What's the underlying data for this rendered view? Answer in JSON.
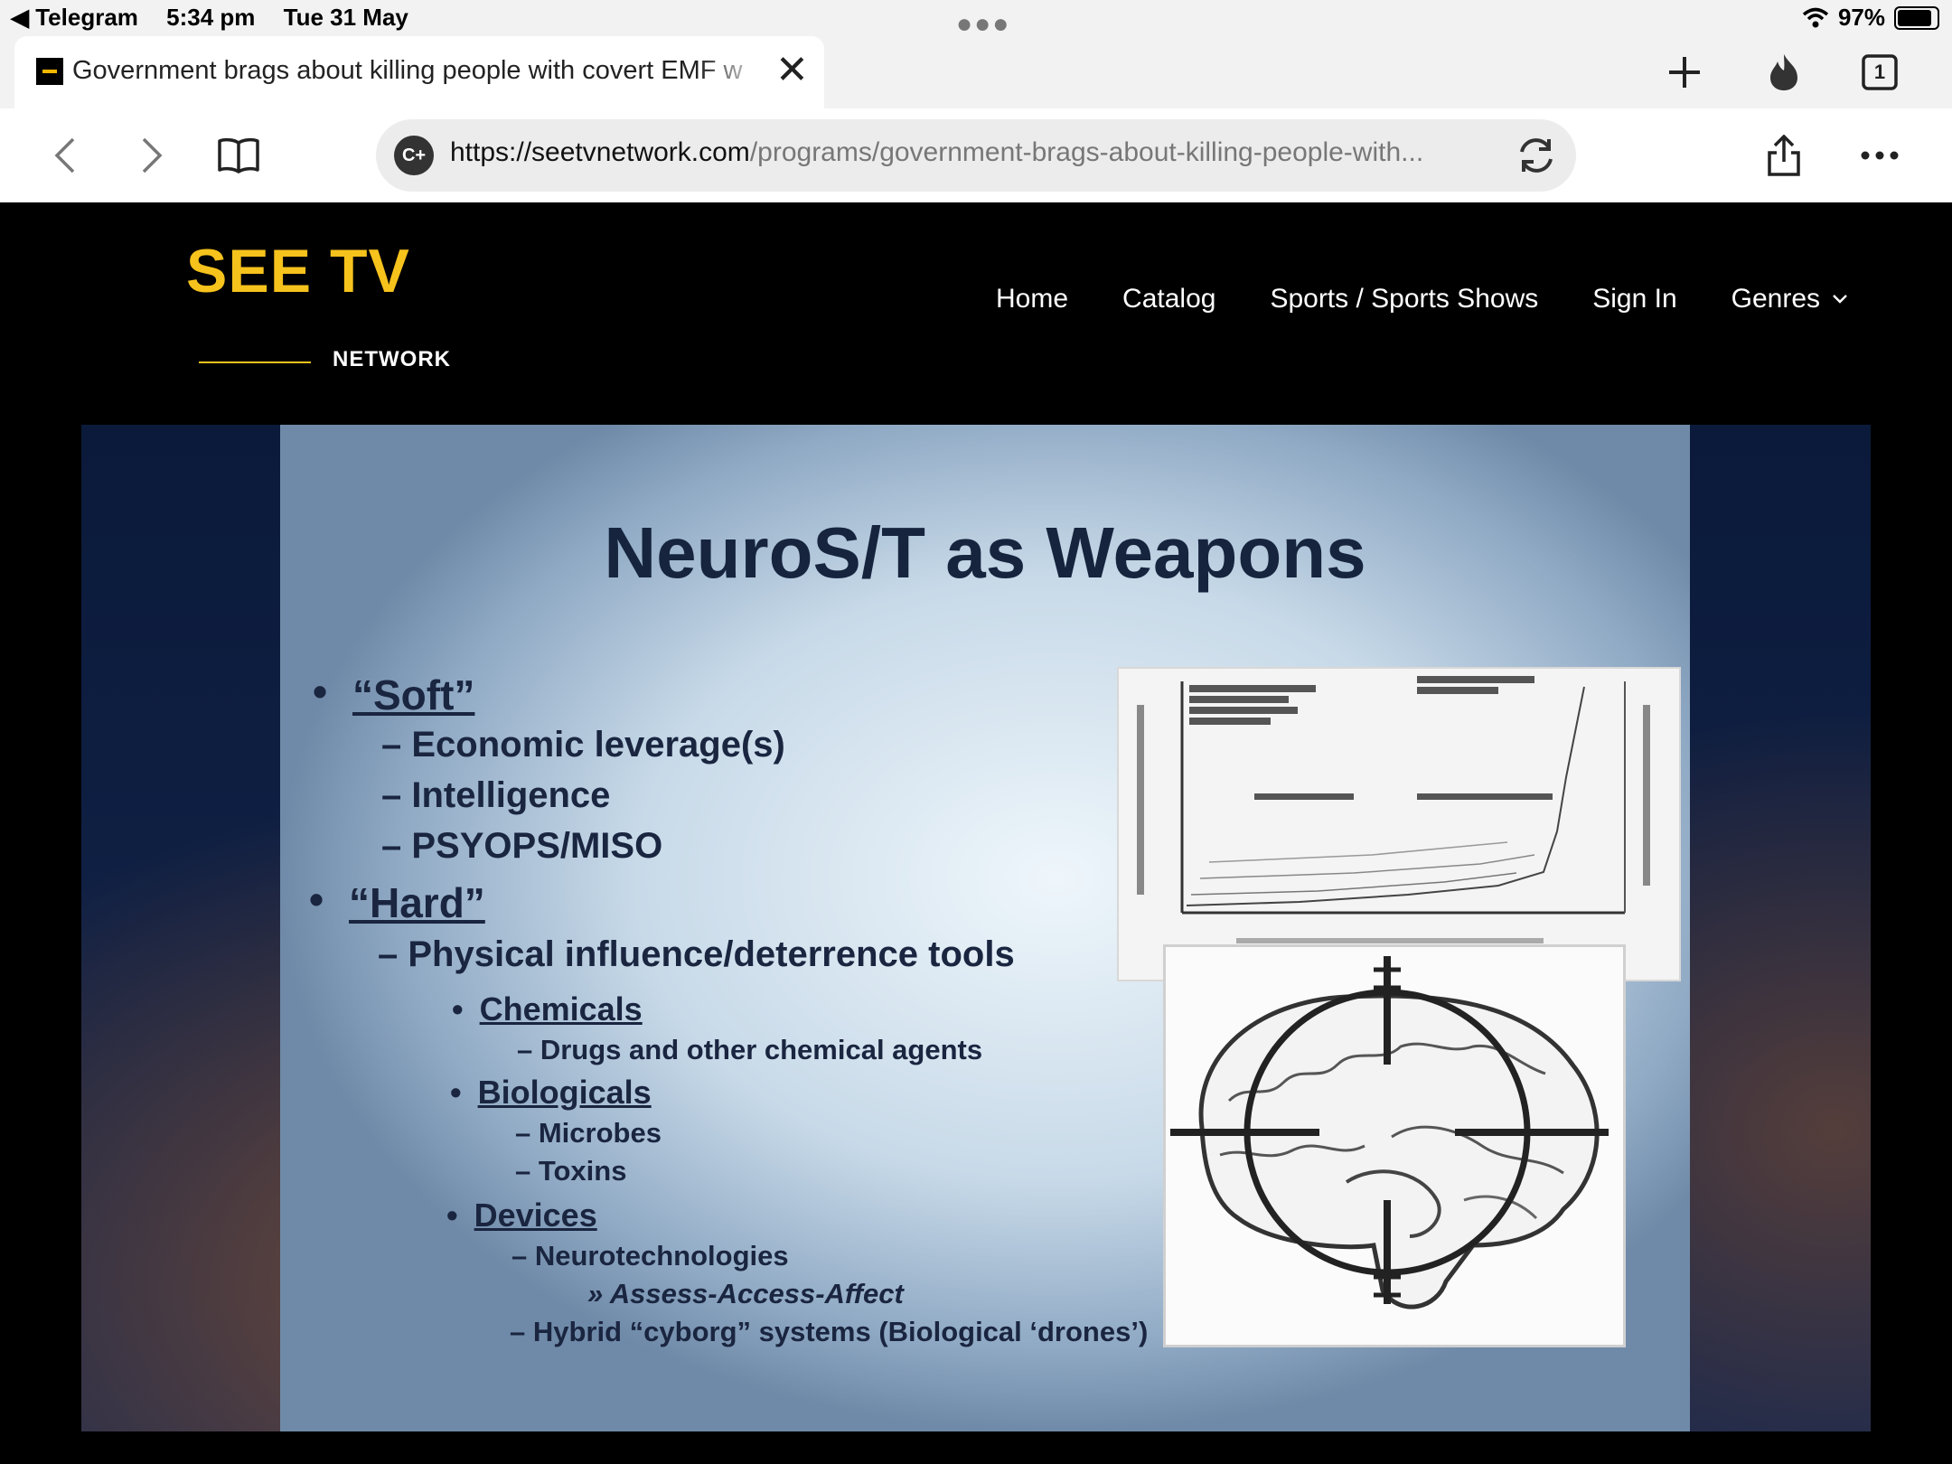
{
  "status_bar": {
    "back_app": "◀ Telegram",
    "time": "5:34 pm",
    "date": "Tue 31 May",
    "battery_pct": "97%",
    "battery_level": 0.97
  },
  "tab": {
    "title": "Government brags about killing people with covert EMF w",
    "tab_count": "1"
  },
  "address": {
    "host": "https://seetvnetwork.com",
    "path": "/programs/government-brags-about-killing-people-with..."
  },
  "site": {
    "logo_main": "SEE TV",
    "logo_sub": "NETWORK",
    "nav": [
      "Home",
      "Catalog",
      "Sports / Sports Shows",
      "Sign In",
      "Genres"
    ],
    "colors": {
      "brand": "#f6c21c",
      "background": "#000000"
    }
  },
  "slide": {
    "title": "NeuroS/T as Weapons",
    "bullets": {
      "soft": "“Soft”",
      "soft_items": [
        "Economic leverage(s)",
        "Intelligence",
        "PSYOPS/MISO"
      ],
      "hard": "“Hard”",
      "hard_item": "Physical influence/deterrence tools",
      "chemicals": "Chemicals",
      "chemicals_item": "Drugs and other chemical agents",
      "biologicals": "Biologicals",
      "biologicals_items": [
        "Microbes",
        "Toxins"
      ],
      "devices": "Devices",
      "devices_item": "Neurotechnologies",
      "devices_sub": "Assess-Access-Affect",
      "hybrid": "Hybrid “cyborg” systems (Biological ‘drones’)"
    }
  }
}
